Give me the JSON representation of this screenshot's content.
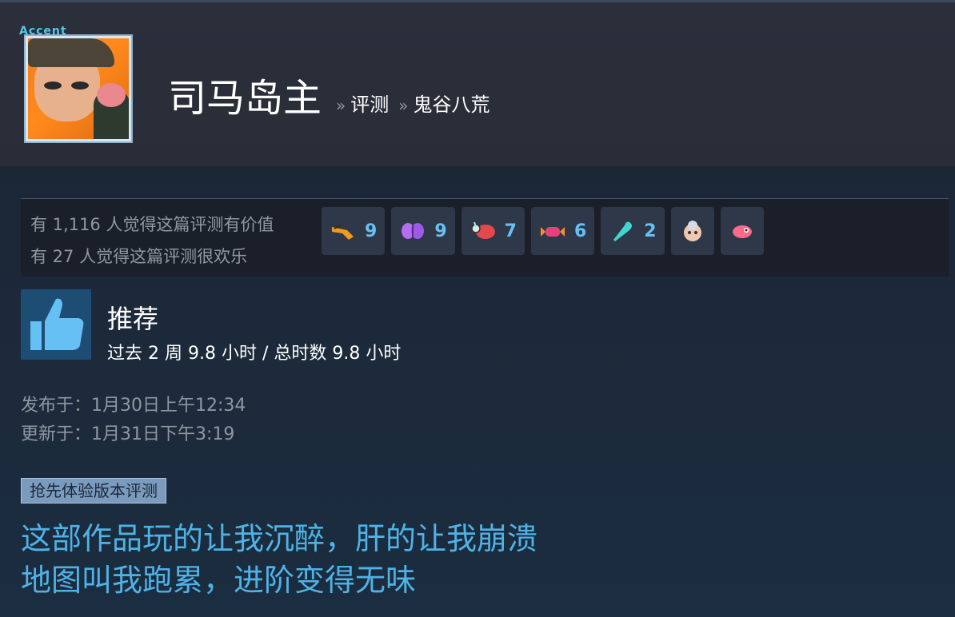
{
  "header": {
    "avatar_tag": "Accent",
    "user_name": "司马岛主",
    "sep1": "»",
    "crumb_reviews": "评测",
    "sep2": "»",
    "crumb_game": "鬼谷八荒"
  },
  "votes": {
    "helpful": "有 1,116 人觉得这篇评测有价值",
    "funny": "有 27 人觉得这篇评测很欢乐"
  },
  "awards": [
    {
      "icon": "orange-trumpet-icon",
      "count": "9"
    },
    {
      "icon": "purple-butterfly-icon",
      "count": "9"
    },
    {
      "icon": "red-fish-icon",
      "count": "7"
    },
    {
      "icon": "candy-icon",
      "count": "6"
    },
    {
      "icon": "teal-wand-icon",
      "count": "2"
    },
    {
      "icon": "grandma-face-icon",
      "count": ""
    },
    {
      "icon": "pink-creature-icon",
      "count": ""
    }
  ],
  "recommendation": {
    "label": "推荐",
    "hours": "过去 2 周 9.8 小时 / 总时数 9.8 小时"
  },
  "dates": {
    "posted": "发布于：1月30日上午12:34",
    "updated": "更新于：1月31日下午3:19"
  },
  "early_access_tag": "抢先体验版本评测",
  "review": {
    "line1": "这部作品玩的让我沉醉，肝的让我崩溃",
    "line2": "地图叫我跑累，进阶变得无味"
  },
  "colors": {
    "accent_blue": "#66c0f4",
    "review_text": "#4fb2e6",
    "header_bg": "#2a2d38",
    "page_bg": "#1b2838"
  }
}
